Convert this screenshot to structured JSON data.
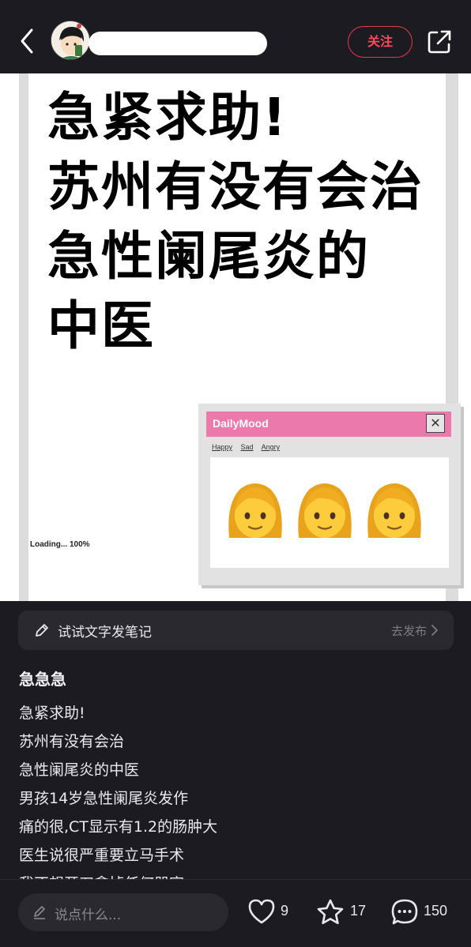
{
  "header": {
    "follow_label": "关注"
  },
  "image": {
    "title_lines": [
      "急紧求助!",
      "苏州有没有会治",
      "急性阑尾炎的",
      "中医"
    ],
    "loading_text": "Loading... 100%",
    "window": {
      "title": "DailyMood",
      "close": "✕",
      "menu": [
        "Happy",
        "Sad",
        "Angry"
      ],
      "emoji": [
        "woman-face",
        "woman-face",
        "woman-face"
      ]
    }
  },
  "prompt_bar": {
    "text": "试试文字发笔记",
    "link": "去发布"
  },
  "post": {
    "title": "急急急",
    "lines": [
      "急紧求助!",
      "苏州有没有会治",
      "急性阑尾炎的中医",
      "男孩14岁急性阑尾炎发作",
      "痛的很,CT显示有1.2的肠肿大",
      "医生说很严重要立马手术",
      "我不想开刀拿掉任何器官"
    ]
  },
  "bottom": {
    "placeholder": "说点什么...",
    "likes": "9",
    "stars": "17",
    "comments": "150"
  },
  "colors": {
    "background": "#1c1b21",
    "follow": "#ff4a5e",
    "window_title": "#ec79ab"
  }
}
